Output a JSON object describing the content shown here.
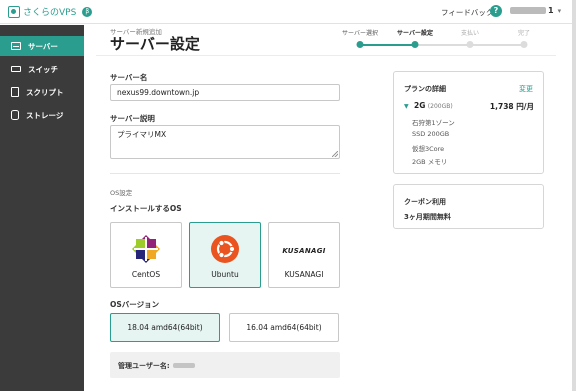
{
  "header": {
    "logo_text": "さくらのVPS",
    "beta_badge": "β",
    "feedback": "フィードバック",
    "help": "?",
    "user_suffix": "1",
    "caret": "▾"
  },
  "sidebar": {
    "items": [
      {
        "label": "サーバー",
        "active": true
      },
      {
        "label": "スイッチ",
        "active": false
      },
      {
        "label": "スクリプト",
        "active": false
      },
      {
        "label": "ストレージ",
        "active": false
      }
    ]
  },
  "page": {
    "breadcrumb": "サーバー新規追加",
    "title": "サーバー設定"
  },
  "steps": [
    {
      "label": "サーバー選択",
      "state": "done"
    },
    {
      "label": "サーバー設定",
      "state": "current"
    },
    {
      "label": "支払い",
      "state": "todo"
    },
    {
      "label": "完了",
      "state": "todo"
    }
  ],
  "form": {
    "server_name_label": "サーバー名",
    "server_name_value": "nexus99.downtown.jp",
    "server_desc_label": "サーバー説明",
    "server_desc_value": "プライマリMX",
    "os_section_label": "OS設定",
    "install_os_label": "インストールするOS",
    "os_options": [
      {
        "name": "CentOS",
        "selected": false
      },
      {
        "name": "Ubuntu",
        "selected": true
      },
      {
        "name": "KUSANAGI",
        "logo_text": "KUSANAGI",
        "selected": false
      }
    ],
    "os_version_label": "OSバージョン",
    "os_versions": [
      {
        "label": "18.04 amd64(64bit)",
        "selected": true
      },
      {
        "label": "16.04 amd64(64bit)",
        "selected": false
      }
    ],
    "admin_user_label": "管理ユーザー名:"
  },
  "plan": {
    "title": "プランの詳細",
    "change": "変更",
    "size": "2G",
    "size_detail": "(200GB)",
    "price": "1,738 円/月",
    "specs": [
      "石狩第1ゾーン",
      "SSD 200GB",
      "仮想3Core",
      "2GB メモリ"
    ]
  },
  "coupon": {
    "title": "クーポン利用",
    "desc": "3ヶ月期間無料"
  },
  "colors": {
    "accent": "#2a9d8f",
    "sidebar_bg": "#3b3b3b",
    "selected_bg": "#e6f4f2"
  }
}
